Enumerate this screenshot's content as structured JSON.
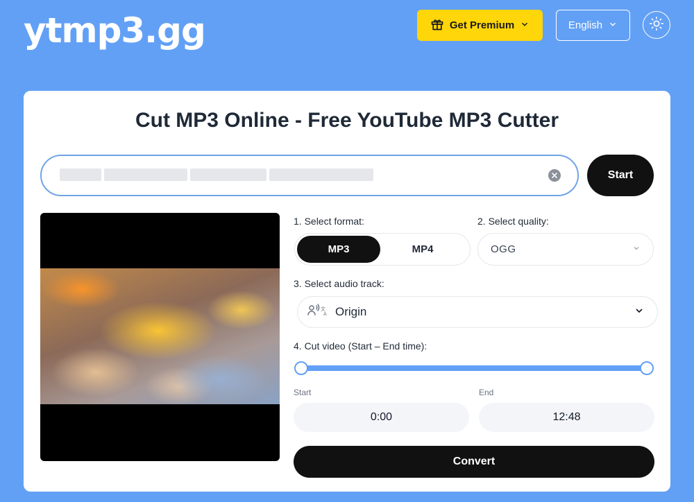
{
  "header": {
    "logo": "ytmp3.gg",
    "premium_label": "Get Premium",
    "language_label": "English"
  },
  "main": {
    "title": "Cut MP3 Online - Free YouTube MP3 Cutter",
    "url_input": {
      "value": "",
      "placeholder": ""
    },
    "start_label": "Start"
  },
  "options": {
    "format_label": "1. Select format:",
    "formats": [
      "MP3",
      "MP4"
    ],
    "selected_format": "MP3",
    "quality_label": "2. Select quality:",
    "quality_value": "OGG",
    "audio_track_label": "3. Select audio track:",
    "audio_track_value": "Origin",
    "cut_label": "4. Cut video (Start – End time):",
    "cut_range": {
      "start_fraction": 0,
      "end_fraction": 1
    },
    "start_label": "Start",
    "start_value": "0:00",
    "end_label": "End",
    "end_value": "12:48",
    "convert_label": "Convert"
  },
  "colors": {
    "background": "#62a0f5",
    "premium": "#ffd60a",
    "primary_button": "#111111",
    "slider": "#62a0f5"
  },
  "icons": {
    "premium": "gift-icon",
    "theme": "sun-icon",
    "clear": "clear-icon",
    "audio_track": "translate-voice-icon",
    "dropdown": "chevron-down-icon"
  }
}
